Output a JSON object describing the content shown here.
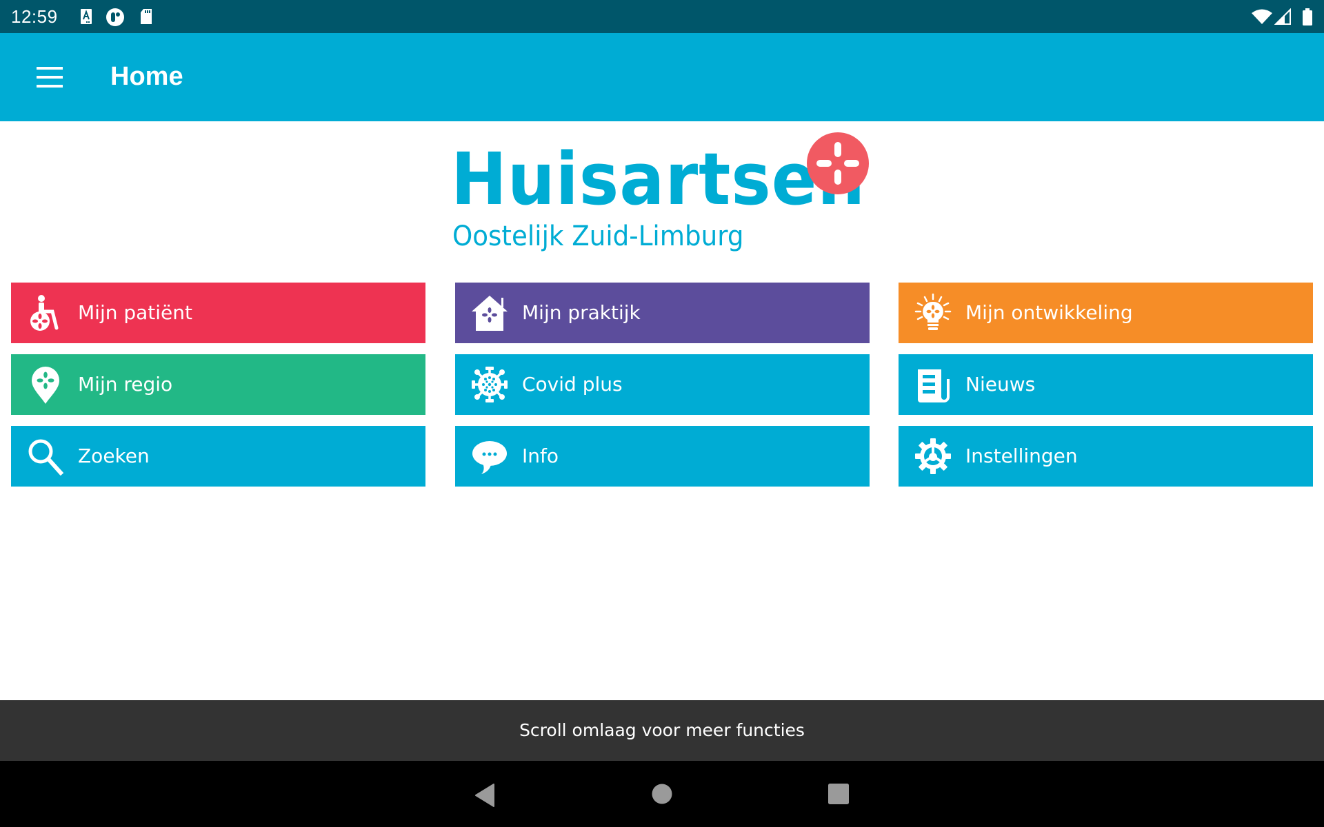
{
  "status_bar": {
    "time": "12:59",
    "left_icons": [
      "font-a-icon",
      "app-circle-icon",
      "sd-card-icon"
    ],
    "right_icons": [
      "wifi-icon",
      "signal-icon",
      "battery-icon"
    ]
  },
  "app_bar": {
    "menu_icon": "hamburger-menu-icon",
    "title": "Home"
  },
  "logo": {
    "title": "Huisartsen",
    "subtitle": "Oostelijk Zuid-Limburg",
    "badge_icon": "medical-plus-icon",
    "colors": {
      "text": "#00acd4",
      "badge": "#f15a62"
    }
  },
  "tiles": [
    {
      "label": "Mijn patiënt",
      "icon": "wheelchair-patient-icon",
      "color": "#ee3352"
    },
    {
      "label": "Mijn praktijk",
      "icon": "house-practice-icon",
      "color": "#5c4d9c"
    },
    {
      "label": "Mijn ontwikkeling",
      "icon": "lightbulb-icon",
      "color": "#f68d27"
    },
    {
      "label": "Mijn regio",
      "icon": "map-pin-icon",
      "color": "#22b886"
    },
    {
      "label": "Covid plus",
      "icon": "virus-icon",
      "color": "#00acd4"
    },
    {
      "label": "Nieuws",
      "icon": "newspaper-icon",
      "color": "#00acd4"
    },
    {
      "label": "Zoeken",
      "icon": "search-icon",
      "color": "#00acd4"
    },
    {
      "label": "Info",
      "icon": "chat-bubble-icon",
      "color": "#00acd4"
    },
    {
      "label": "Instellingen",
      "icon": "gear-icon",
      "color": "#00acd4"
    }
  ],
  "snackbar": {
    "message": "Scroll omlaag voor meer functies"
  },
  "nav_bar": {
    "buttons": [
      "back",
      "home",
      "recents"
    ]
  }
}
